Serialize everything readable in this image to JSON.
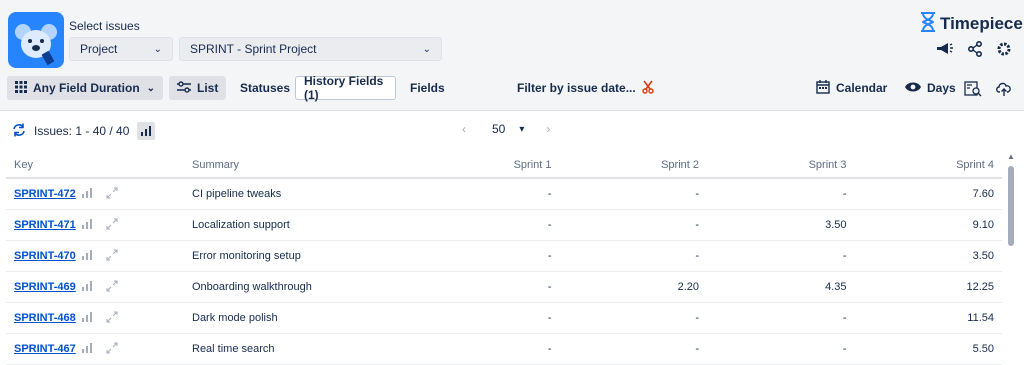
{
  "header": {
    "select_label": "Select issues",
    "project_dropdown": "Project",
    "sprint_dropdown": "SPRINT - Sprint Project",
    "brand_name": "Timepiece"
  },
  "toolbar": {
    "field_duration": "Any Field Duration",
    "list": "List",
    "statuses": "Statuses",
    "history_fields": "History Fields (1)",
    "fields": "Fields",
    "filter_by_date": "Filter by issue date...",
    "calendar": "Calendar",
    "days": "Days"
  },
  "subbar": {
    "issues_count": "Issues: 1 - 40 / 40",
    "page_size": "50"
  },
  "table": {
    "columns": [
      "Key",
      "Summary",
      "Sprint 1",
      "Sprint 2",
      "Sprint 3",
      "Sprint 4"
    ],
    "rows": [
      {
        "key": "SPRINT-472",
        "summary": "CI pipeline tweaks",
        "s1": "-",
        "s2": "-",
        "s3": "-",
        "s4": "7.60"
      },
      {
        "key": "SPRINT-471",
        "summary": "Localization support",
        "s1": "-",
        "s2": "-",
        "s3": "3.50",
        "s4": "9.10"
      },
      {
        "key": "SPRINT-470",
        "summary": "Error monitoring setup",
        "s1": "-",
        "s2": "-",
        "s3": "-",
        "s4": "3.50"
      },
      {
        "key": "SPRINT-469",
        "summary": "Onboarding walkthrough",
        "s1": "-",
        "s2": "2.20",
        "s3": "4.35",
        "s4": "12.25"
      },
      {
        "key": "SPRINT-468",
        "summary": "Dark mode polish",
        "s1": "-",
        "s2": "-",
        "s3": "-",
        "s4": "11.54"
      },
      {
        "key": "SPRINT-467",
        "summary": "Real time search",
        "s1": "-",
        "s2": "-",
        "s3": "-",
        "s4": "5.50"
      }
    ]
  },
  "icons": {
    "brand": "hourglass-icon",
    "announce": "megaphone-icon",
    "share": "share-icon",
    "settings": "gear-icon",
    "refresh": "refresh-icon",
    "chart": "bar-chart-icon",
    "expand": "expand-icon"
  },
  "colors": {
    "brand_blue": "#2684ff",
    "link_blue": "#0052cc",
    "filter_red": "#de350b"
  }
}
